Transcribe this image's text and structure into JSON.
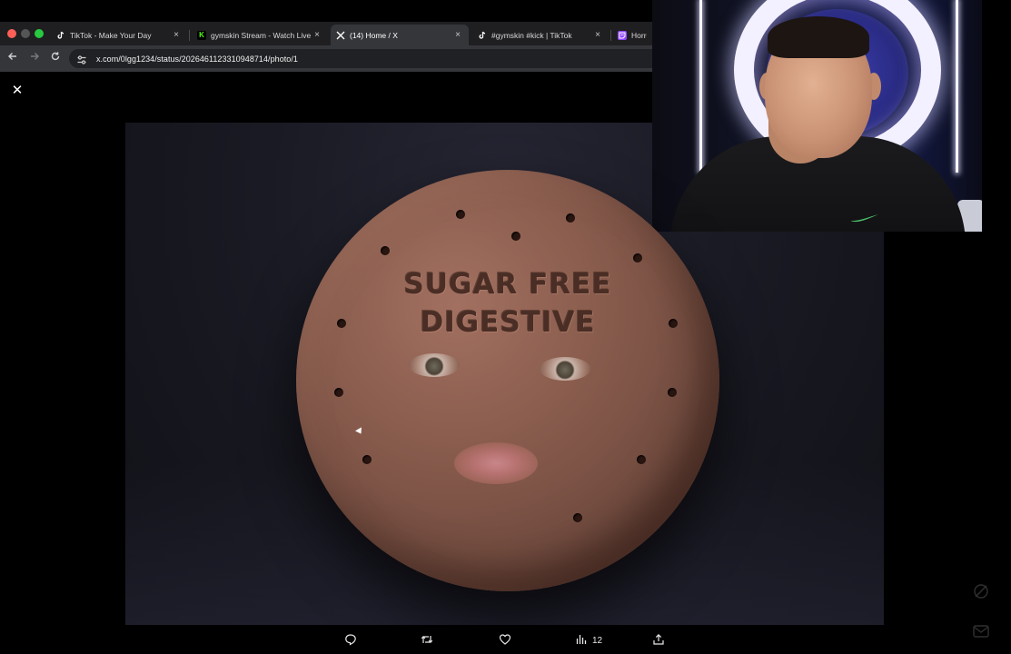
{
  "browser": {
    "tabs": [
      {
        "title": "TikTok - Make Your Day",
        "icon": "tiktok-icon",
        "active": false
      },
      {
        "title": "gymskin Stream - Watch Live",
        "icon": "kick-icon",
        "active": false
      },
      {
        "title": "(14) Home / X",
        "icon": "x-icon",
        "active": true
      },
      {
        "title": "#gymskin #kick | TikTok",
        "icon": "tiktok-icon",
        "active": false
      },
      {
        "title": "Horror",
        "icon": "twitch-icon",
        "active": false
      }
    ],
    "tab_close_glyph": "×",
    "url": "x.com/0lgg1234/status/2026461123310948714/photo/1"
  },
  "viewer": {
    "close_glyph": "✕",
    "image_text_line1": "SUGAR FREE",
    "image_text_line2": "DIGESTIVE"
  },
  "post_actions": {
    "reply_icon": "reply-icon",
    "repost_icon": "repost-icon",
    "like_icon": "like-icon",
    "views_icon": "views-icon",
    "views_count": "12",
    "share_icon": "share-icon"
  },
  "colors": {
    "page_bg": "#000000",
    "chrome_tabstrip": "#1f1f22",
    "chrome_toolbar": "#35363a",
    "omnibox": "#202124",
    "kick_green": "#53fc18",
    "twitch_purple": "#9146ff"
  }
}
